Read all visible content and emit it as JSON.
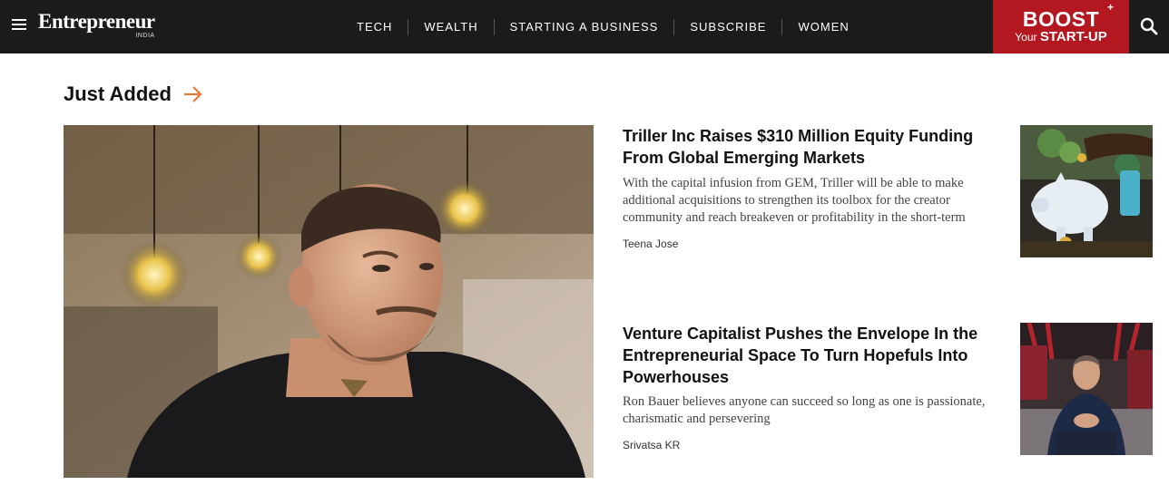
{
  "header": {
    "logo_main": "Entrepreneur",
    "logo_sub": "INDIA",
    "nav": [
      "TECH",
      "WEALTH",
      "STARTING A BUSINESS",
      "SUBSCRIBE",
      "WOMEN"
    ],
    "boost_top": "BOOST",
    "boost_your": "Your",
    "boost_startup": "START-UP",
    "boost_plus": "+"
  },
  "section": {
    "title": "Just Added"
  },
  "articles": [
    {
      "headline": "Triller Inc Raises $310 Million Equity Funding From Global Emerging Markets",
      "summary": "With the capital infusion from GEM, Triller will be able to make additional acquisitions to strengthen its toolbox for the creator community and reach breakeven or profitability in the short-term",
      "author": "Teena Jose"
    },
    {
      "headline": "Venture Capitalist Pushes the Envelope In the Entrepreneurial Space To Turn Hopefuls Into Powerhouses",
      "summary": "Ron Bauer believes anyone can succeed so long as one is passionate, charismatic and persevering",
      "author": "Srivatsa KR"
    }
  ],
  "colors": {
    "header_bg": "#1b1b1b",
    "boost_bg": "#b3171f",
    "accent_arrow": "#e8793a"
  }
}
